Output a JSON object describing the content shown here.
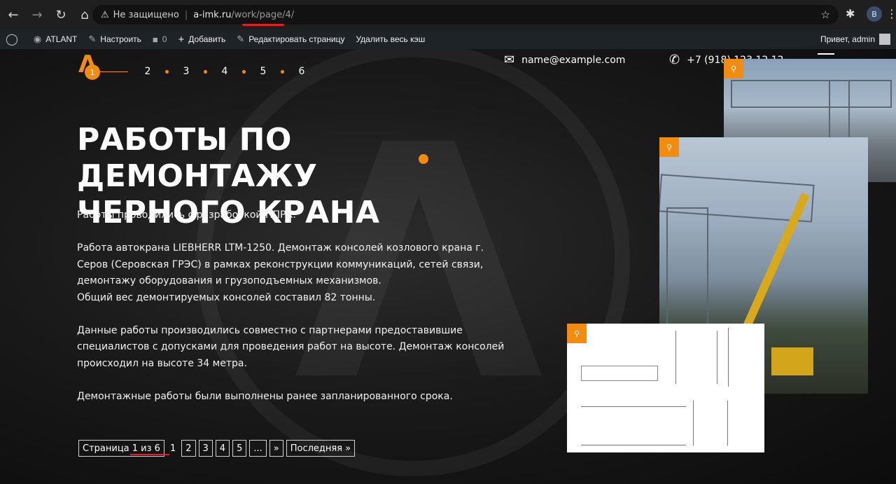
{
  "browser": {
    "security_label": "Не защищено",
    "url_host": "a-imk.ru",
    "url_path": "/work/page/4/",
    "profile_initial": "В"
  },
  "wp_admin_bar": {
    "site_name": "ATLANT",
    "customize": "Настроить",
    "comments_count": "0",
    "add_new": "Добавить",
    "edit_page": "Редактировать страницу",
    "clear_cache": "Удалить весь кэш",
    "greeting": "Привет, admin"
  },
  "header": {
    "active_step": "1",
    "steps": [
      "2",
      "3",
      "4",
      "5",
      "6"
    ],
    "email": "name@example.com",
    "phone": "+7 (918) 123 12 12"
  },
  "main": {
    "title_line1": "РАБОТЫ ПО ДЕМОНТАЖУ",
    "title_line2": "ЧЕРНОГО КРАНА",
    "paragraphs": [
      "Работы проводились с разработкой ППРК.",
      "Работа автокрана LIEBHERR LTM-1250. Демонтаж консолей козлового крана г. Серов (Серовская ГРЭС) в рамках реконструкции коммуникаций, сетей связи, демонтажу оборудования и грузоподъемных механизмов.",
      "Общий вес демонтируемых консолей составил 82 тонны.",
      "Данные работы производились совместно с партнерами предоставившие специалистов с допусками для проведения работ на высоте. Демонтаж консолей происходил на высоте 34 метра.",
      "Демонтажные работы были выполнены ранее запланированного срока."
    ]
  },
  "pagination": {
    "label": "Страница 1 из 6",
    "current": "1",
    "pages": [
      "2",
      "3",
      "4",
      "5"
    ],
    "ellipsis": "...",
    "next": "»",
    "last": "Последняя »"
  },
  "colors": {
    "accent": "#f28c0f",
    "annotation_red": "#e02020"
  }
}
